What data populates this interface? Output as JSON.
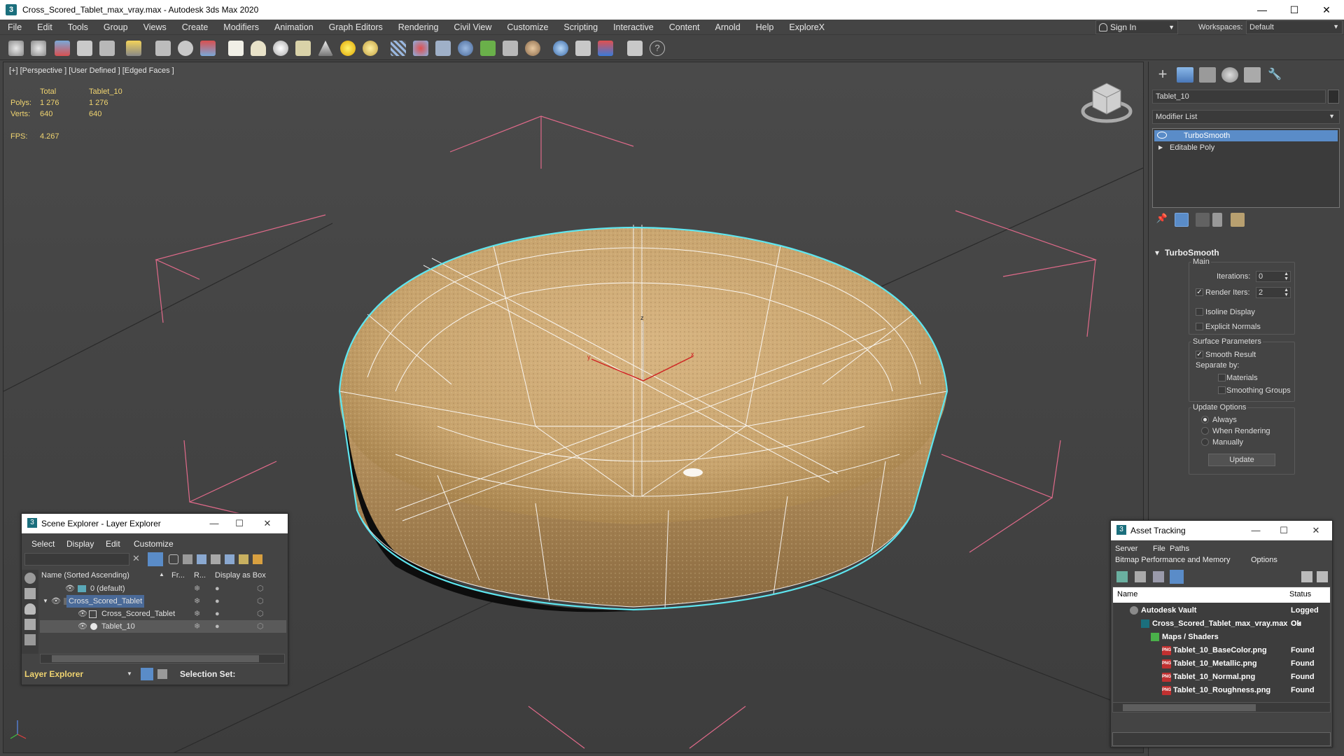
{
  "window": {
    "title": "Cross_Scored_Tablet_max_vray.max - Autodesk 3ds Max 2020",
    "icon_text": "3",
    "controls": {
      "minimize": "—",
      "maximize": "☐",
      "close": "✕"
    }
  },
  "menubar": {
    "items": [
      "File",
      "Edit",
      "Tools",
      "Group",
      "Views",
      "Create",
      "Modifiers",
      "Animation",
      "Graph Editors",
      "Rendering",
      "Civil View",
      "Customize",
      "Scripting",
      "Interactive",
      "Content",
      "Arnold",
      "Help",
      "ExploreX"
    ],
    "sign_in": "Sign In",
    "workspaces_label": "Workspaces:",
    "workspace_value": "Default"
  },
  "viewport": {
    "label": "[+] [Perspective ] [User Defined ] [Edged Faces ]",
    "stats": {
      "header_total": "Total",
      "header_object": "Tablet_10",
      "polys_label": "Polys:",
      "polys_total": "1 276",
      "polys_object": "1 276",
      "verts_label": "Verts:",
      "verts_total": "640",
      "verts_object": "640",
      "fps_label": "FPS:",
      "fps_value": "4.267"
    },
    "gizmo_axis_labels": {
      "x": "x",
      "y": "y",
      "z": "z"
    }
  },
  "command_panel": {
    "object_name": "Tablet_10",
    "modifier_list_label": "Modifier List",
    "stack": [
      {
        "label": "TurboSmooth",
        "selected": true
      },
      {
        "label": "Editable Poly",
        "selected": false
      }
    ],
    "turbosmooth": {
      "title": "TurboSmooth",
      "main_label": "Main",
      "iterations_label": "Iterations:",
      "iterations_value": "0",
      "render_iters_label": "Render Iters:",
      "render_iters_value": "2",
      "render_iters_checked": "✓",
      "isoline_label": "Isoline Display",
      "explicit_normals_label": "Explicit Normals",
      "surface_params_label": "Surface Parameters",
      "smooth_result_label": "Smooth Result",
      "smooth_result_checked": "✓",
      "separate_by_label": "Separate by:",
      "materials_label": "Materials",
      "smoothing_groups_label": "Smoothing Groups",
      "update_options_label": "Update Options",
      "always_label": "Always",
      "when_rendering_label": "When Rendering",
      "manually_label": "Manually",
      "update_button": "Update"
    }
  },
  "scene_explorer": {
    "title": "Scene Explorer - Layer Explorer",
    "menu": [
      "Select",
      "Display",
      "Edit",
      "Customize"
    ],
    "columns": {
      "name": "Name (Sorted Ascending)",
      "sort_arrow": "▲",
      "frozen": "Fr...",
      "renderable": "R...",
      "display_as_box": "Display as Box"
    },
    "rows": [
      {
        "label": "0 (default)",
        "indent": 1
      },
      {
        "label": "Cross_Scored_Tablet",
        "indent": 1
      },
      {
        "label": "Cross_Scored_Tablet",
        "indent": 2
      },
      {
        "label": "Tablet_10",
        "indent": 2
      }
    ],
    "footer_explorer": "Layer Explorer",
    "footer_selection_set": "Selection Set:"
  },
  "asset_tracking": {
    "title": "Asset Tracking",
    "menu_row1": [
      "Server",
      "File",
      "Paths"
    ],
    "menu_row2": [
      "Bitmap Performance and Memory",
      "Options"
    ],
    "col_name": "Name",
    "col_status": "Status",
    "rows": [
      {
        "name": "Autodesk Vault",
        "status": "Logged Ou",
        "indent": 22
      },
      {
        "name": "Cross_Scored_Tablet_max_vray.max",
        "status": "Ok",
        "indent": 38
      },
      {
        "name": "Maps / Shaders",
        "status": "",
        "indent": 52
      },
      {
        "name": "Tablet_10_BaseColor.png",
        "status": "Found",
        "indent": 68
      },
      {
        "name": "Tablet_10_Metallic.png",
        "status": "Found",
        "indent": 68
      },
      {
        "name": "Tablet_10_Normal.png",
        "status": "Found",
        "indent": 68
      },
      {
        "name": "Tablet_10_Roughness.png",
        "status": "Found",
        "indent": 68
      }
    ],
    "png_badge": "PNG"
  },
  "colors": {
    "accent_selection": "#5a8cc8",
    "stats_text": "#f0d470",
    "wire_highlight": "#5ee6f0",
    "bounding_box": "#e06a8a"
  }
}
